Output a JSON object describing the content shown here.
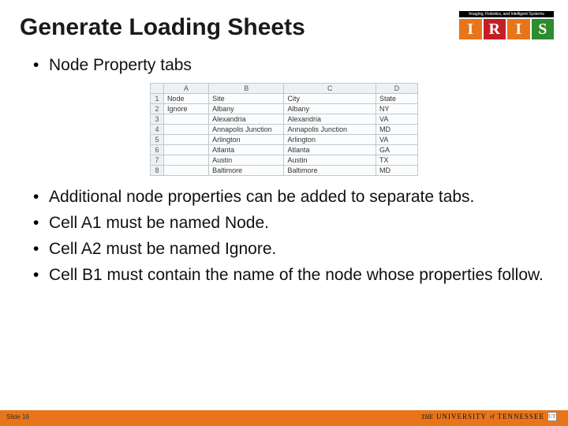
{
  "title": "Generate Loading Sheets",
  "logo": {
    "tagline": "Imaging, Robotics, and Intelligent Systems",
    "letters": [
      "I",
      "R",
      "I",
      "S"
    ]
  },
  "bullet1": "Node Property tabs",
  "spreadsheet": {
    "columns": [
      "A",
      "B",
      "C",
      "D"
    ],
    "headers": {
      "A": "Node",
      "B": "Site",
      "C": "City",
      "D": "State"
    },
    "rows": [
      {
        "n": "1",
        "A": "Node",
        "B": "Site",
        "C": "City",
        "D": "State"
      },
      {
        "n": "2",
        "A": "Ignore",
        "B": "Albany",
        "C": "Albany",
        "D": "NY"
      },
      {
        "n": "3",
        "A": "",
        "B": "Alexandria",
        "C": "Alexandria",
        "D": "VA"
      },
      {
        "n": "4",
        "A": "",
        "B": "Annapolis Junction",
        "C": "Annapolis Junction",
        "D": "MD"
      },
      {
        "n": "5",
        "A": "",
        "B": "Arlington",
        "C": "Arlington",
        "D": "VA"
      },
      {
        "n": "6",
        "A": "",
        "B": "Atlanta",
        "C": "Atlanta",
        "D": "GA"
      },
      {
        "n": "7",
        "A": "",
        "B": "Austin",
        "C": "Austin",
        "D": "TX"
      },
      {
        "n": "8",
        "A": "",
        "B": "Baltimore",
        "C": "Baltimore",
        "D": "MD"
      }
    ]
  },
  "bullets2": [
    "Additional node properties can be added to separate tabs.",
    "Cell A1 must be named Node.",
    "Cell A2 must be named Ignore.",
    "Cell B1 must contain the name of the node whose properties follow."
  ],
  "footer": {
    "slide_label": "Slide 16",
    "university": {
      "the": "THE",
      "univ": "UNIVERSITY",
      "of": "of",
      "tenn": "TENNESSEE",
      "icon": "UT"
    }
  }
}
